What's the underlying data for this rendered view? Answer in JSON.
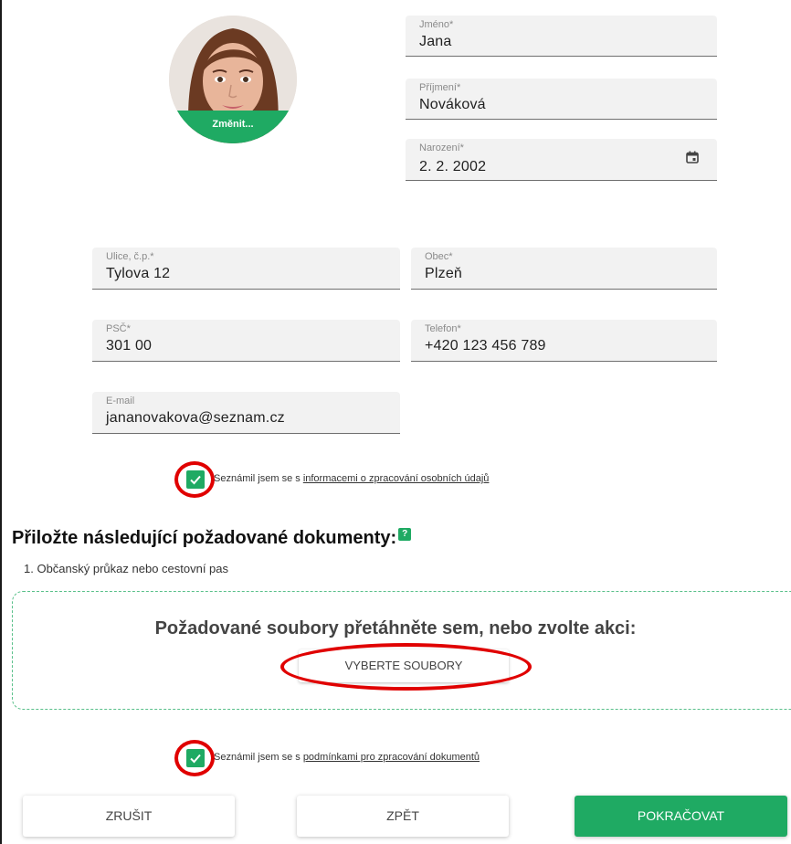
{
  "avatar": {
    "change_label": "Změnit..."
  },
  "fields": {
    "first_name": {
      "label": "Jméno*",
      "value": "Jana"
    },
    "last_name": {
      "label": "Příjmení*",
      "value": "Nováková"
    },
    "birth_date": {
      "label": "Narození*",
      "value": "2. 2. 2002",
      "icon": "calendar-icon"
    },
    "street": {
      "label": "Ulice, č.p.*",
      "value": "Tylova 12"
    },
    "city": {
      "label": "Obec*",
      "value": "Plzeň"
    },
    "zip": {
      "label": "PSČ*",
      "value": "301 00"
    },
    "phone": {
      "label": "Telefon*",
      "value": "+420 123 456 789"
    },
    "email": {
      "label": "E-mail",
      "value": "jananovakova@seznam.cz"
    }
  },
  "consent_personal": {
    "text": "Seznámil jsem se s ",
    "link": "informacemi o zpracování osobních údajů",
    "checked": true
  },
  "documents": {
    "heading": "Přiložte následující požadované dokumenty:",
    "help_label": "?",
    "items": [
      "1. Občanský průkaz nebo cestovní pas"
    ],
    "dropzone_title": "Požadované soubory přetáhněte sem, nebo zvolte akci:",
    "select_files_label": "VYBERTE SOUBORY"
  },
  "consent_documents": {
    "text": "Seznámil jsem se s ",
    "link": "podmínkami pro zpracování dokumentů",
    "checked": true
  },
  "actions": {
    "cancel": "ZRUŠIT",
    "back": "ZPĚT",
    "continue": "POKRAČOVAT"
  },
  "colors": {
    "accent": "#1faa63",
    "highlight_ring": "#e00000",
    "field_bg": "#f2f2f2"
  }
}
